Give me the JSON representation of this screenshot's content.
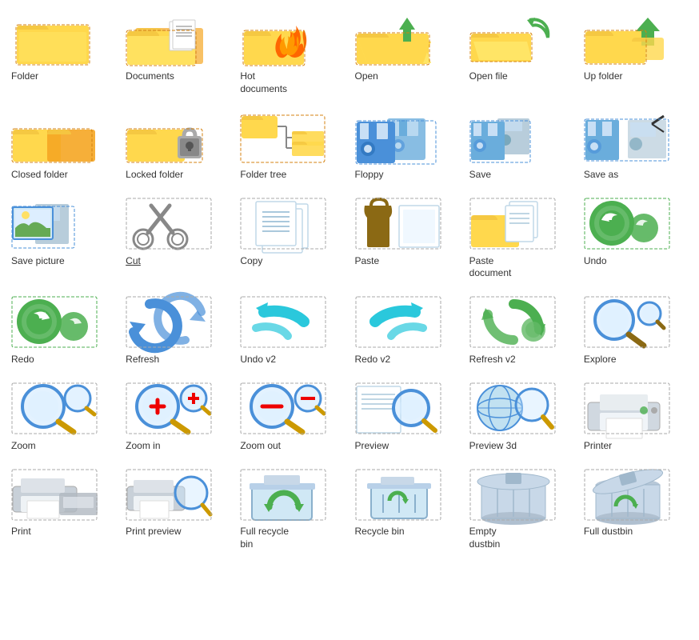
{
  "icons": [
    {
      "id": "folder",
      "label": "Folder",
      "type": "folder"
    },
    {
      "id": "documents",
      "label": "Documents",
      "type": "documents"
    },
    {
      "id": "hot-documents",
      "label": "Hot\ndocuments",
      "type": "hot-documents"
    },
    {
      "id": "open",
      "label": "Open",
      "type": "open-folder"
    },
    {
      "id": "open-file",
      "label": "Open file",
      "type": "open-file"
    },
    {
      "id": "up-folder",
      "label": "Up folder",
      "type": "up-folder"
    },
    {
      "id": "closed-folder",
      "label": "Closed folder",
      "type": "closed-folder"
    },
    {
      "id": "locked-folder",
      "label": "Locked folder",
      "type": "locked-folder"
    },
    {
      "id": "folder-tree",
      "label": "Folder tree",
      "type": "folder-tree"
    },
    {
      "id": "floppy",
      "label": "Floppy",
      "type": "floppy"
    },
    {
      "id": "save",
      "label": "Save",
      "type": "save"
    },
    {
      "id": "save-as",
      "label": "Save as",
      "type": "save-as"
    },
    {
      "id": "save-picture",
      "label": "Save picture",
      "type": "save-picture"
    },
    {
      "id": "cut",
      "label": "Cut",
      "type": "cut",
      "underline": true
    },
    {
      "id": "copy",
      "label": "Copy",
      "type": "copy"
    },
    {
      "id": "paste",
      "label": "Paste",
      "type": "paste"
    },
    {
      "id": "paste-document",
      "label": "Paste\ndocument",
      "type": "paste-document"
    },
    {
      "id": "undo",
      "label": "Undo",
      "type": "undo"
    },
    {
      "id": "redo",
      "label": "Redo",
      "type": "redo"
    },
    {
      "id": "refresh",
      "label": "Refresh",
      "type": "refresh"
    },
    {
      "id": "undo-v2",
      "label": "Undo v2",
      "type": "undo-v2"
    },
    {
      "id": "redo-v2",
      "label": "Redo v2",
      "type": "redo-v2"
    },
    {
      "id": "refresh-v2",
      "label": "Refresh v2",
      "type": "refresh-v2"
    },
    {
      "id": "explore",
      "label": "Explore",
      "type": "explore"
    },
    {
      "id": "zoom",
      "label": "Zoom",
      "type": "zoom"
    },
    {
      "id": "zoom-in",
      "label": "Zoom in",
      "type": "zoom-in"
    },
    {
      "id": "zoom-out",
      "label": "Zoom out",
      "type": "zoom-out"
    },
    {
      "id": "preview",
      "label": "Preview",
      "type": "preview"
    },
    {
      "id": "preview-3d",
      "label": "Preview 3d",
      "type": "preview-3d"
    },
    {
      "id": "printer",
      "label": "Printer",
      "type": "printer"
    },
    {
      "id": "print",
      "label": "Print",
      "type": "print"
    },
    {
      "id": "print-preview",
      "label": "Print preview",
      "type": "print-preview"
    },
    {
      "id": "full-recycle-bin",
      "label": "Full recycle\nbin",
      "type": "full-recycle-bin"
    },
    {
      "id": "recycle-bin",
      "label": "Recycle bin",
      "type": "recycle-bin"
    },
    {
      "id": "empty-dustbin",
      "label": "Empty\ndustbin",
      "type": "empty-dustbin"
    },
    {
      "id": "full-dustbin",
      "label": "Full dustbin",
      "type": "full-dustbin"
    }
  ]
}
